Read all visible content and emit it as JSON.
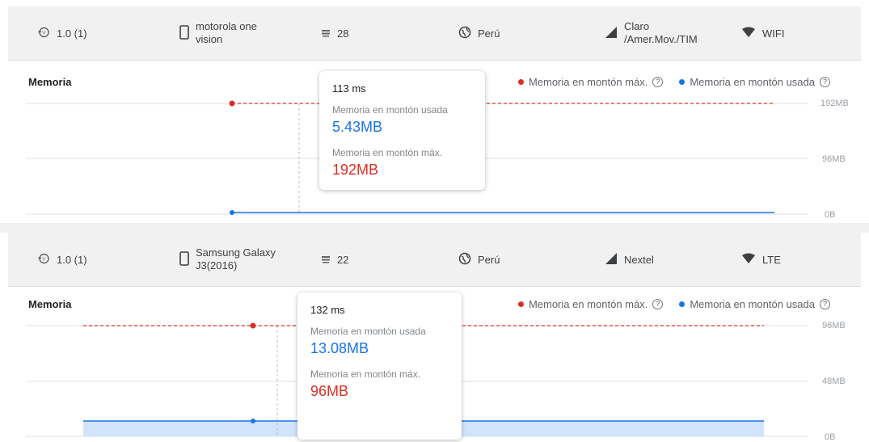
{
  "panels": [
    {
      "info": {
        "version": "1.0 (1)",
        "device": [
          "motorola one",
          "vision"
        ],
        "api": "28",
        "country": "Perú",
        "carrier": [
          "Claro",
          "/Amer.Mov./TIM"
        ],
        "network": "WIFI"
      },
      "title": "Memoria",
      "legend": {
        "max": "Memoria en montón máx.",
        "used": "Memoria en montón usada",
        "help": "?"
      },
      "yticks": [
        "192MB",
        "96MB",
        "0B"
      ],
      "tooltip": {
        "time": "113 ms",
        "used_label": "Memoria en montón usada",
        "used_value": "5.43MB",
        "max_label": "Memoria en montón máx.",
        "max_value": "192MB"
      }
    },
    {
      "info": {
        "version": "1.0 (1)",
        "device": [
          "Samsung Galaxy",
          "J3(2016)"
        ],
        "api": "22",
        "country": "Perú",
        "carrier": [
          "Nextel"
        ],
        "network": "LTE"
      },
      "title": "Memoria",
      "legend": {
        "max": "Memoria en montón máx.",
        "used": "Memoria en montón usada",
        "help": "?"
      },
      "yticks": [
        "96MB",
        "48MB",
        "0B"
      ],
      "tooltip": {
        "time": "132 ms",
        "used_label": "Memoria en montón usada",
        "used_value": "13.08MB",
        "max_label": "Memoria en montón máx.",
        "max_value": "96MB"
      }
    }
  ],
  "chart_data": [
    {
      "type": "line",
      "title": "Memoria",
      "ylim": [
        0,
        192
      ],
      "ylabel": "",
      "series": [
        {
          "name": "Memoria en montón máx.",
          "color": "#d93025",
          "style": "dashed",
          "values": [
            192,
            192
          ]
        },
        {
          "name": "Memoria en montón usada",
          "color": "#1a73e8",
          "style": "solid",
          "values": [
            5.43,
            5.43
          ]
        }
      ]
    },
    {
      "type": "area",
      "title": "Memoria",
      "ylim": [
        0,
        96
      ],
      "ylabel": "",
      "series": [
        {
          "name": "Memoria en montón máx.",
          "color": "#d93025",
          "style": "dashed",
          "values": [
            96,
            96
          ]
        },
        {
          "name": "Memoria en montón usada",
          "color": "#1a73e8",
          "style": "solid-fill",
          "values": [
            13.08,
            13.08
          ]
        }
      ]
    }
  ],
  "colors": {
    "max": "#d93025",
    "used": "#1a73e8"
  },
  "icons": [
    "history-icon",
    "phone-icon",
    "api-icon",
    "globe-icon",
    "signal-icon",
    "wifi-icon"
  ]
}
